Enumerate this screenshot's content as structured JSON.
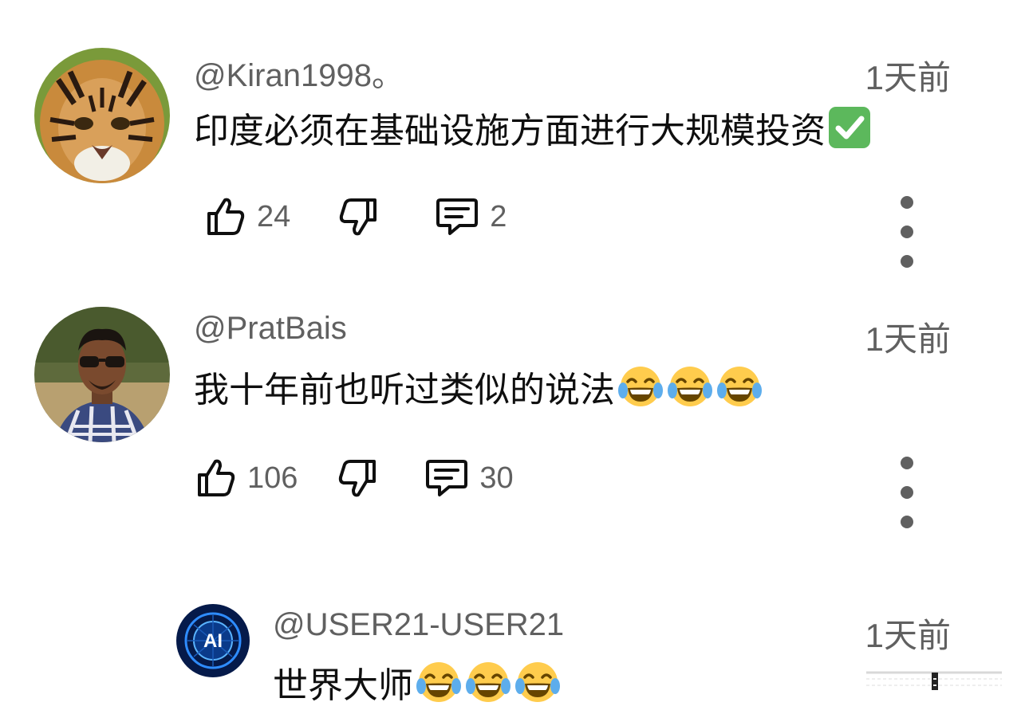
{
  "comments": [
    {
      "author": "@Kiran1998。",
      "time": "1天前",
      "text": "印度必须在基础设施方面进行大规模投资",
      "emojis": [
        "check-mark-emoji"
      ],
      "likes": "24",
      "replies": "2",
      "avatar": "tiger-photo"
    },
    {
      "author": "@PratBais",
      "time": "1天前",
      "text": "我十年前也听过类似的说法",
      "emojis": [
        "tears-of-joy-emoji",
        "tears-of-joy-emoji",
        "tears-of-joy-emoji"
      ],
      "likes": "106",
      "replies": "30",
      "avatar": "man-with-sunglasses-photo"
    },
    {
      "author": "@USER21-USER21",
      "time": "1天前",
      "text": "世界大师",
      "emojis": [
        "tears-of-joy-emoji",
        "tears-of-joy-emoji",
        "tears-of-joy-emoji"
      ],
      "avatar": "ai-logo",
      "avatar_label": "AI"
    }
  ],
  "colors": {
    "text": "#0f0f0f",
    "secondary": "#606060",
    "check_green": "#5cb85c",
    "emoji_yellow": "#ffcc4d",
    "tear_blue": "#5dadec"
  }
}
